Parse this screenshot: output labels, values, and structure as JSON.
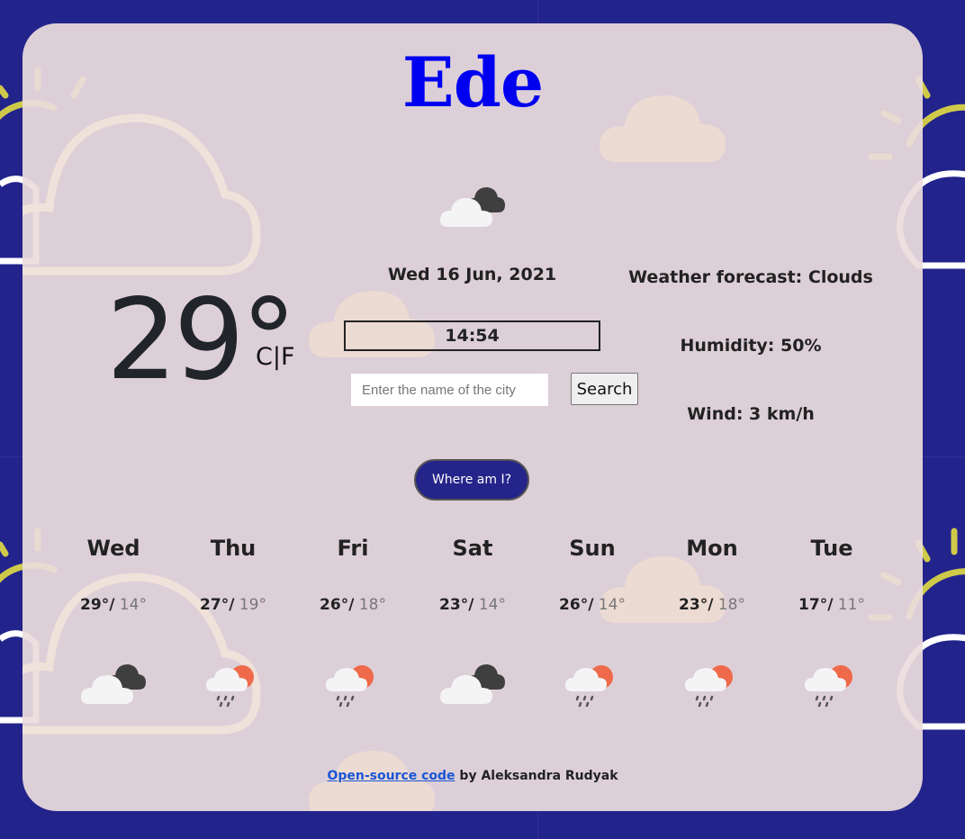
{
  "city": "Ede",
  "current": {
    "temperature": "29°",
    "unit_c": "C",
    "unit_sep": "|",
    "unit_f": "F",
    "date": "Wed 16 Jun, 2021",
    "time": "14:54",
    "description": "Weather forecast: Clouds",
    "humidity": "Humidity: 50%",
    "wind": "Wind: 3 km/h",
    "icon": "broken-clouds-icon"
  },
  "search": {
    "placeholder": "Enter the name of the city",
    "value": "",
    "button_label": "Search"
  },
  "location_button_label": "Where am I?",
  "forecast": [
    {
      "day": "Wed",
      "max": "29°/",
      "min": " 14°",
      "icon": "broken-clouds-icon"
    },
    {
      "day": "Thu",
      "max": "27°/",
      "min": " 19°",
      "icon": "sun-rain-icon"
    },
    {
      "day": "Fri",
      "max": "26°/",
      "min": " 18°",
      "icon": "sun-rain-icon"
    },
    {
      "day": "Sat",
      "max": "23°/",
      "min": " 14°",
      "icon": "broken-clouds-icon"
    },
    {
      "day": "Sun",
      "max": "26°/",
      "min": " 14°",
      "icon": "sun-rain-icon"
    },
    {
      "day": "Mon",
      "max": "23°/",
      "min": " 18°",
      "icon": "sun-rain-icon"
    },
    {
      "day": "Tue",
      "max": "17°/",
      "min": " 11°",
      "icon": "sun-rain-icon"
    }
  ],
  "footer": {
    "link_text": "Open-source code",
    "suffix": " by Aleksandra Rudyak"
  },
  "colors": {
    "background": "#23238c",
    "card": "#e6d6d6",
    "city": "#0000f0",
    "button": "#24248a",
    "link": "#1a55d6"
  }
}
